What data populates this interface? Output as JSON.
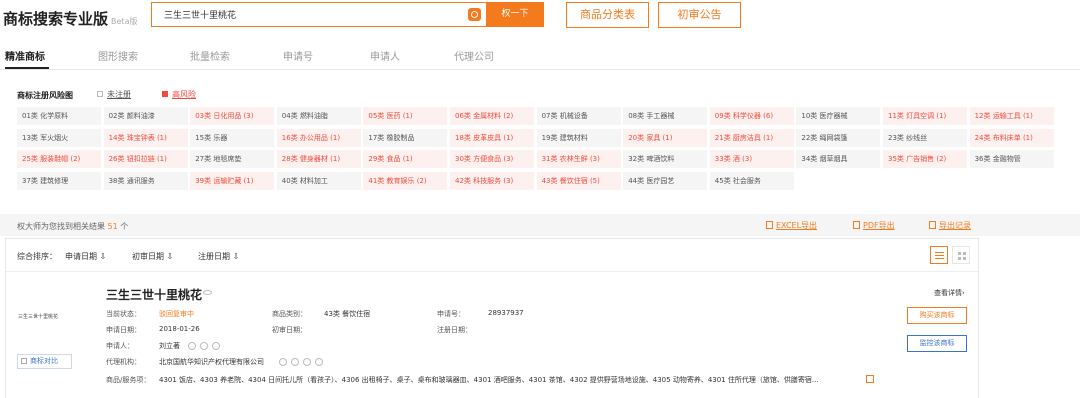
{
  "header": {
    "logo": "商标搜索专业版",
    "beta": "Beta版",
    "search_value": "三生三世十里桃花",
    "search_button": "权一下",
    "class_table_button": "商品分类表",
    "gazette_button": "初审公告"
  },
  "tabs": [
    "精准商标",
    "图形搜索",
    "批量检索",
    "申请号",
    "申请人",
    "代理公司"
  ],
  "risk_map": {
    "title": "商标注册风险图",
    "legend_unregistered": "未注册",
    "legend_high_risk": "高风险",
    "risk_color": "#f04a3c",
    "rows": [
      [
        {
          "t": "01类 化学原料",
          "r": false
        },
        {
          "t": "02类 颜料油漆",
          "r": false
        },
        {
          "t": "03类 日化用品 (3)",
          "r": true
        },
        {
          "t": "04类 燃料油脂",
          "r": false
        },
        {
          "t": "05类 医药 (1)",
          "r": true
        },
        {
          "t": "06类 金属材料 (2)",
          "r": true
        },
        {
          "t": "07类 机械设备",
          "r": false
        },
        {
          "t": "08类 手工器械",
          "r": false
        },
        {
          "t": "09类 科学仪器 (6)",
          "r": true
        },
        {
          "t": "10类 医疗器械",
          "r": false
        },
        {
          "t": "11类 灯具空调 (1)",
          "r": true
        },
        {
          "t": "12类 运输工具 (1)",
          "r": true
        }
      ],
      [
        {
          "t": "13类 军火烟火",
          "r": false
        },
        {
          "t": "14类 珠宝钟表 (1)",
          "r": true
        },
        {
          "t": "15类 乐器",
          "r": false
        },
        {
          "t": "16类 办公用品 (1)",
          "r": true
        },
        {
          "t": "17类 橡胶制品",
          "r": false
        },
        {
          "t": "18类 皮革皮具 (1)",
          "r": true
        },
        {
          "t": "19类 建筑材料",
          "r": false
        },
        {
          "t": "20类 家具 (1)",
          "r": true
        },
        {
          "t": "21类 厨房洁具 (1)",
          "r": true
        },
        {
          "t": "22类 绳网袋篷",
          "r": false
        },
        {
          "t": "23类 纱线丝",
          "r": false
        },
        {
          "t": "24类 布料床单 (1)",
          "r": true
        }
      ],
      [
        {
          "t": "25类 服装鞋帽 (2)",
          "r": true
        },
        {
          "t": "26类 钮扣拉链 (1)",
          "r": true
        },
        {
          "t": "27类 地毯席垫",
          "r": false
        },
        {
          "t": "28类 健身器材 (1)",
          "r": true
        },
        {
          "t": "29类 食品 (1)",
          "r": true
        },
        {
          "t": "30类 方便食品 (3)",
          "r": true
        },
        {
          "t": "31类 农林生鲜 (3)",
          "r": true
        },
        {
          "t": "32类 啤酒饮料",
          "r": false
        },
        {
          "t": "33类 酒 (3)",
          "r": true
        },
        {
          "t": "34类 烟草烟具",
          "r": false
        },
        {
          "t": "35类 广告销售 (2)",
          "r": true
        },
        {
          "t": "36类 金融物管",
          "r": false
        }
      ],
      [
        {
          "t": "37类 建筑修理",
          "r": false
        },
        {
          "t": "38类 通讯服务",
          "r": false
        },
        {
          "t": "39类 运输贮藏 (1)",
          "r": true
        },
        {
          "t": "40类 材料加工",
          "r": false
        },
        {
          "t": "41类 教育娱乐 (2)",
          "r": true
        },
        {
          "t": "42类 科技服务 (3)",
          "r": true
        },
        {
          "t": "43类 餐饮住宿 (5)",
          "r": true
        },
        {
          "t": "44类 医疗园艺",
          "r": false
        },
        {
          "t": "45类 社会服务",
          "r": false
        }
      ]
    ]
  },
  "results": {
    "prefix": "权大师为您找到相关结果",
    "count": "51",
    "suffix": "个",
    "export_excel": "EXCEL导出",
    "export_pdf": "PDF导出",
    "export_log": "导出记录"
  },
  "sort": {
    "label": "综合排序：",
    "apply_date": "申请日期 ⇩",
    "first_trial_date": "初审日期 ⇩",
    "reg_date": "注册日期 ⇩"
  },
  "trademark": {
    "image_text": "三生三世十里桃花",
    "compare": "商标对比",
    "name": "三生三世十里桃花",
    "status_label": "当前状态：",
    "status": "驳回复审中",
    "category_label": "商品类别：",
    "category": "43类 餐饮住宿",
    "reg_no_label": "申请号：",
    "reg_no": "28937937",
    "apply_date_label": "申请日期：",
    "apply_date": "2018-01-26",
    "trial_date_label": "初审日期：",
    "register_date_label": "注册日期：",
    "applicant_label": "申请人：",
    "applicant": "刘立著",
    "agency_label": "代理机构：",
    "agency": "北京国航华知识产权代理有限公司",
    "services_label": "商品/服务项：",
    "services": "4301 饭店、4303 养老院、4304 日间托儿所（看孩子）、4306 出租椅子、桌子、桌布和玻璃器皿、4301 酒吧服务、4301 茶馆、4302 提供野营场地设施、4305 动物寄养、4301 住所代理（旅馆、供膳寄宿...",
    "detail_link": "查看详情›",
    "buy_button": "购买该商标",
    "monitor_button": "监控该商标"
  }
}
